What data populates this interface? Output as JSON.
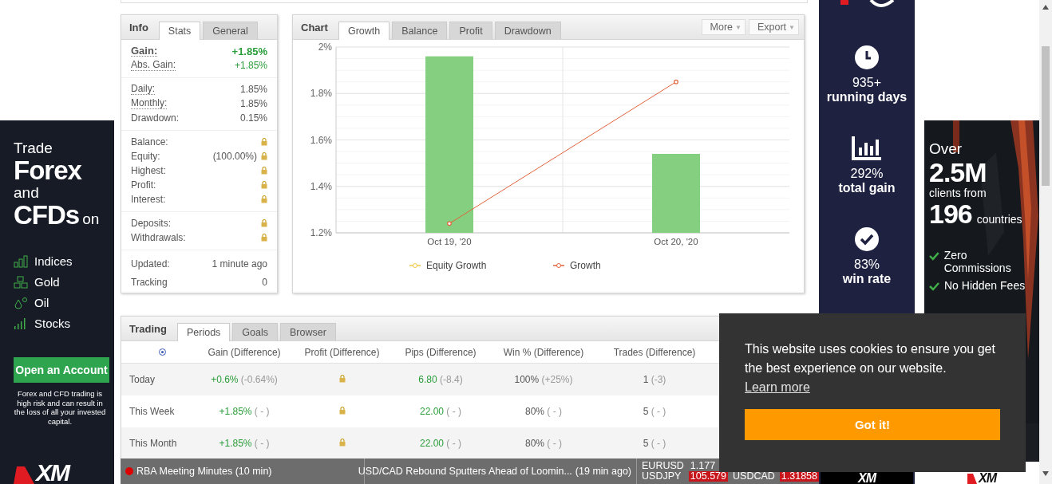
{
  "info": {
    "label": "Info",
    "tabs": [
      {
        "label": "Stats",
        "selected": true
      },
      {
        "label": "General",
        "selected": false
      }
    ],
    "groups": [
      [
        {
          "label": "Gain:",
          "value": "+1.85%",
          "positive": true,
          "hint": true,
          "emphasis": true
        },
        {
          "label": "Abs. Gain:",
          "value": "+1.85%",
          "positive": true,
          "hint": true,
          "emphasis": false
        }
      ],
      [
        {
          "label": "Daily:",
          "value": "1.85%",
          "positive": false,
          "hint": true
        },
        {
          "label": "Monthly:",
          "value": "1.85%",
          "positive": false,
          "hint": true
        },
        {
          "label": "Drawdown:",
          "value": "0.15%",
          "positive": false,
          "hint": false
        }
      ],
      [
        {
          "label": "Balance:",
          "locked": true
        },
        {
          "label": "Equity:",
          "value": "(100.00%)",
          "locked": true
        },
        {
          "label": "Highest:",
          "locked": true
        },
        {
          "label": "Profit:",
          "locked": true
        },
        {
          "label": "Interest:",
          "locked": true
        }
      ],
      [
        {
          "label": "Deposits:",
          "locked": true
        },
        {
          "label": "Withdrawals:",
          "locked": true
        }
      ],
      [
        {
          "label": "Updated:",
          "value": "1 minute ago",
          "positive": false
        },
        {
          "label": "Tracking",
          "value": "0",
          "positive": false
        }
      ]
    ]
  },
  "chart_panel": {
    "label": "Chart",
    "tabs": [
      {
        "label": "Growth",
        "selected": true
      },
      {
        "label": "Balance",
        "selected": false
      },
      {
        "label": "Profit",
        "selected": false
      },
      {
        "label": "Drawdown",
        "selected": false
      }
    ],
    "buttons": [
      {
        "label": "More",
        "arrow": "▼"
      },
      {
        "label": "Export",
        "arrow": "▼"
      }
    ],
    "chart_data": {
      "type": "bar",
      "categories": [
        "Oct 19, '20",
        "Oct 20, '20"
      ],
      "grid": true,
      "series": [
        {
          "color": "#85cf81",
          "values": [
            1.96,
            1.54
          ]
        },
        {
          "name": "Equity Growth",
          "type": "line",
          "marker": true,
          "color": "#f2c94c",
          "values": [
            null,
            null
          ]
        },
        {
          "name": "Growth",
          "type": "line",
          "marker": true,
          "color": "#e1643c",
          "values": [
            1.24,
            1.85
          ]
        }
      ],
      "ylim": [
        1.2,
        2.0
      ],
      "yticks": [
        {
          "value": 1.2,
          "label": "1.2%"
        },
        {
          "value": 1.4,
          "label": "1.4%"
        },
        {
          "value": 1.6,
          "label": "1.6%"
        },
        {
          "value": 1.8,
          "label": "1.8%"
        },
        {
          "value": 2.0,
          "label": "2%"
        }
      ]
    }
  },
  "trading": {
    "label": "Trading",
    "tabs": [
      {
        "label": "Periods",
        "selected": true
      },
      {
        "label": "Goals",
        "selected": false
      },
      {
        "label": "Browser",
        "selected": false
      }
    ],
    "columns": [
      "Gain (Difference)",
      "Profit (Difference)",
      "Pips (Difference)",
      "Win % (Difference)",
      "Trades (Difference)"
    ],
    "rows": [
      {
        "period": "Today",
        "cells": [
          {
            "value": "+0.6%",
            "difference": "(-0.64%)",
            "positive": true
          },
          {
            "kind": "locked"
          },
          {
            "value": "6.80",
            "difference": "(-8.4)",
            "positive": true
          },
          {
            "value": "100%",
            "difference": "(+25%)",
            "positive": false
          },
          {
            "value": "1",
            "difference": "(-3)",
            "positive": false
          }
        ]
      },
      {
        "period": "This Week",
        "cells": [
          {
            "value": "+1.85%",
            "difference": "( - )",
            "positive": true
          },
          {
            "kind": "locked"
          },
          {
            "value": "22.00",
            "difference": "( - )",
            "positive": true
          },
          {
            "value": "80%",
            "difference": "( - )",
            "positive": false
          },
          {
            "value": "5",
            "difference": "( - )",
            "positive": false
          }
        ]
      },
      {
        "period": "This Month",
        "cells": [
          {
            "value": "+1.85%",
            "difference": "( - )",
            "positive": true
          },
          {
            "kind": "locked"
          },
          {
            "value": "22.00",
            "difference": "( - )",
            "positive": true
          },
          {
            "value": "80%",
            "difference": "( - )",
            "positive": false
          },
          {
            "value": "5",
            "difference": "( - )",
            "positive": false
          }
        ]
      }
    ]
  },
  "ticker": {
    "events": [
      {
        "title": "RBA Meeting Minutes (10 min)",
        "live": true
      }
    ],
    "news": [
      {
        "title": "USD/CAD Rebound Sputters Ahead of Loomin...",
        "time": "(19 min ago)"
      }
    ],
    "quotes": [
      {
        "symbol": "EURUSD",
        "price": "1.177",
        "down": false
      },
      {
        "symbol": "USDJPY",
        "price": "105.579",
        "down": true
      },
      {
        "symbol": "USDCAD",
        "price": "1.31858",
        "down": true
      }
    ]
  },
  "left_ad": {
    "lines": [
      {
        "text": "Trade",
        "kind": "small"
      },
      {
        "text": "Forex",
        "kind": "big"
      },
      {
        "text": "and",
        "kind": "small"
      }
    ],
    "last_line": {
      "big": "CFDs",
      "small": "on"
    },
    "items": [
      {
        "label": "Indices",
        "kind": "bars"
      },
      {
        "label": "Gold",
        "kind": "gold"
      },
      {
        "label": "Oil",
        "kind": "drops"
      },
      {
        "label": "Stocks",
        "kind": "signal"
      }
    ],
    "button": "Open an Account",
    "disclaimer": "Forex and CFD trading is high risk and can result in the loss of all your invested capital.",
    "logo": "XM"
  },
  "stats_ad": {
    "stats": [
      {
        "kind": "clock",
        "value": "935+",
        "label": "running days"
      },
      {
        "kind": "chart",
        "value": "292%",
        "label": "total gain"
      },
      {
        "kind": "check",
        "value": "83%",
        "label": "win rate"
      }
    ],
    "logo": "XM"
  },
  "clients_ad": {
    "intro": "Over",
    "count": "2.5M",
    "middle": "clients from",
    "countries": "196",
    "countries_label": "countries",
    "features": [
      "Zero Commissions",
      "No Hidden Fees"
    ],
    "logo": "XM"
  },
  "cookie_banner": {
    "message": "This website uses cookies to ensure you get the best experience on our website.",
    "link": "Learn more",
    "button": "Got it!"
  }
}
